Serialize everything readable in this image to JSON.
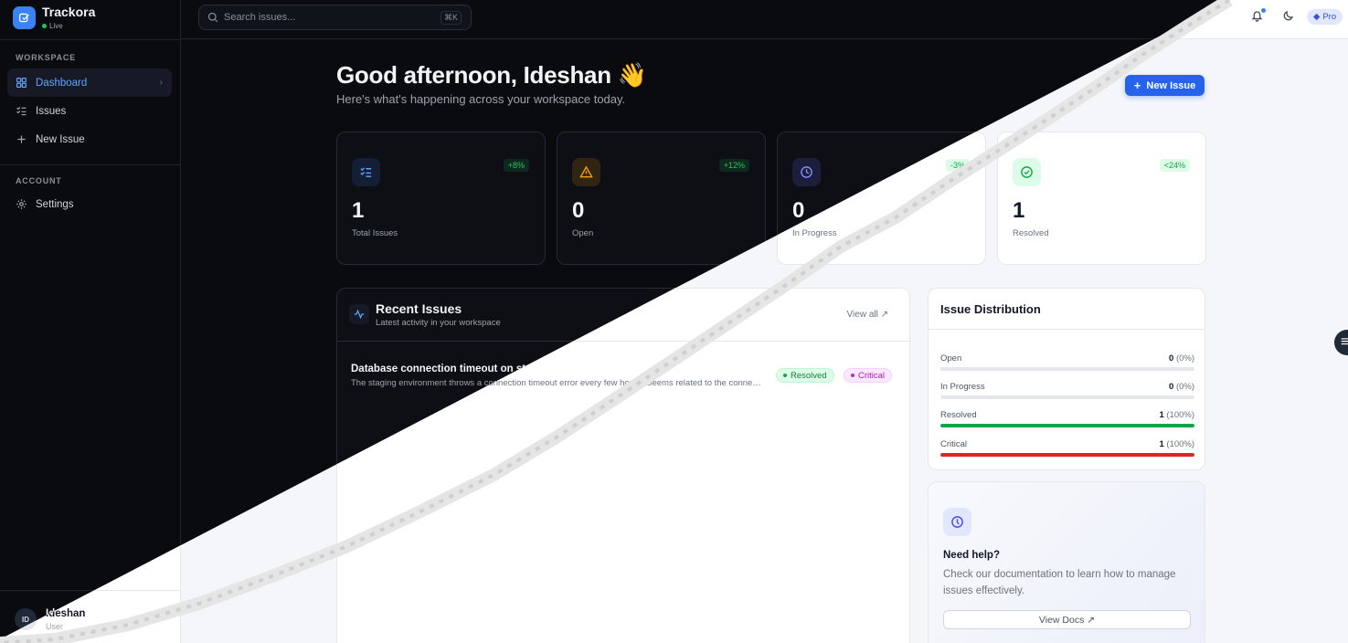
{
  "brand": {
    "name": "Trackora",
    "status": "Live"
  },
  "sidebar": {
    "workspace_label": "WORKSPACE",
    "account_label": "ACCOUNT",
    "items": [
      {
        "label": "Dashboard",
        "icon": "dashboard-icon",
        "active": true
      },
      {
        "label": "Issues",
        "icon": "list-icon"
      },
      {
        "label": "New Issue",
        "icon": "plus-icon"
      }
    ],
    "account_items": [
      {
        "label": "Settings",
        "icon": "gear-icon"
      }
    ],
    "user": {
      "initials": "ID",
      "name": "Ideshan",
      "role": "User"
    }
  },
  "topbar": {
    "search_placeholder": "Search issues...",
    "shortcut": "⌘K",
    "plan": "Pro"
  },
  "header": {
    "greeting": "Good afternoon, Ideshan",
    "wave": "👋",
    "subtitle": "Here's what's happening across your workspace today.",
    "new_issue_label": "New Issue"
  },
  "stats": [
    {
      "value": "1",
      "label": "Total Issues",
      "trend": "+8%",
      "color": "#3b82f6"
    },
    {
      "value": "0",
      "label": "Open",
      "trend": "+12%",
      "color": "#f59e0b"
    },
    {
      "value": "0",
      "label": "In Progress",
      "trend": "-3%",
      "color": "#6366f1"
    },
    {
      "value": "1",
      "label": "Resolved",
      "trend": "<24%",
      "color": "#22c55e"
    }
  ],
  "recent": {
    "title": "Recent Issues",
    "subtitle": "Latest activity in your workspace",
    "view_all": "View all",
    "issues": [
      {
        "title": "Database connection timeout on staging",
        "description": "The staging environment throws a connection timeout error every few hours. Seems related to the connection pool.",
        "status": "Resolved",
        "priority": "Critical"
      }
    ]
  },
  "distribution": {
    "title": "Issue Distribution",
    "rows": [
      {
        "label": "Open",
        "count": "0",
        "pct": "(0%)",
        "fraction": 0,
        "color": "#9ca3af"
      },
      {
        "label": "In Progress",
        "count": "0",
        "pct": "(0%)",
        "fraction": 0,
        "color": "#6366f1"
      },
      {
        "label": "Resolved",
        "count": "1",
        "pct": "(100%)",
        "fraction": 1,
        "color": "#16a34a"
      },
      {
        "label": "Critical",
        "count": "1",
        "pct": "(100%)",
        "fraction": 1,
        "color": "#dc2626"
      }
    ]
  },
  "help": {
    "title": "Need help?",
    "text": "Check our documentation to learn how to manage issues effectively.",
    "button": "View Docs"
  }
}
